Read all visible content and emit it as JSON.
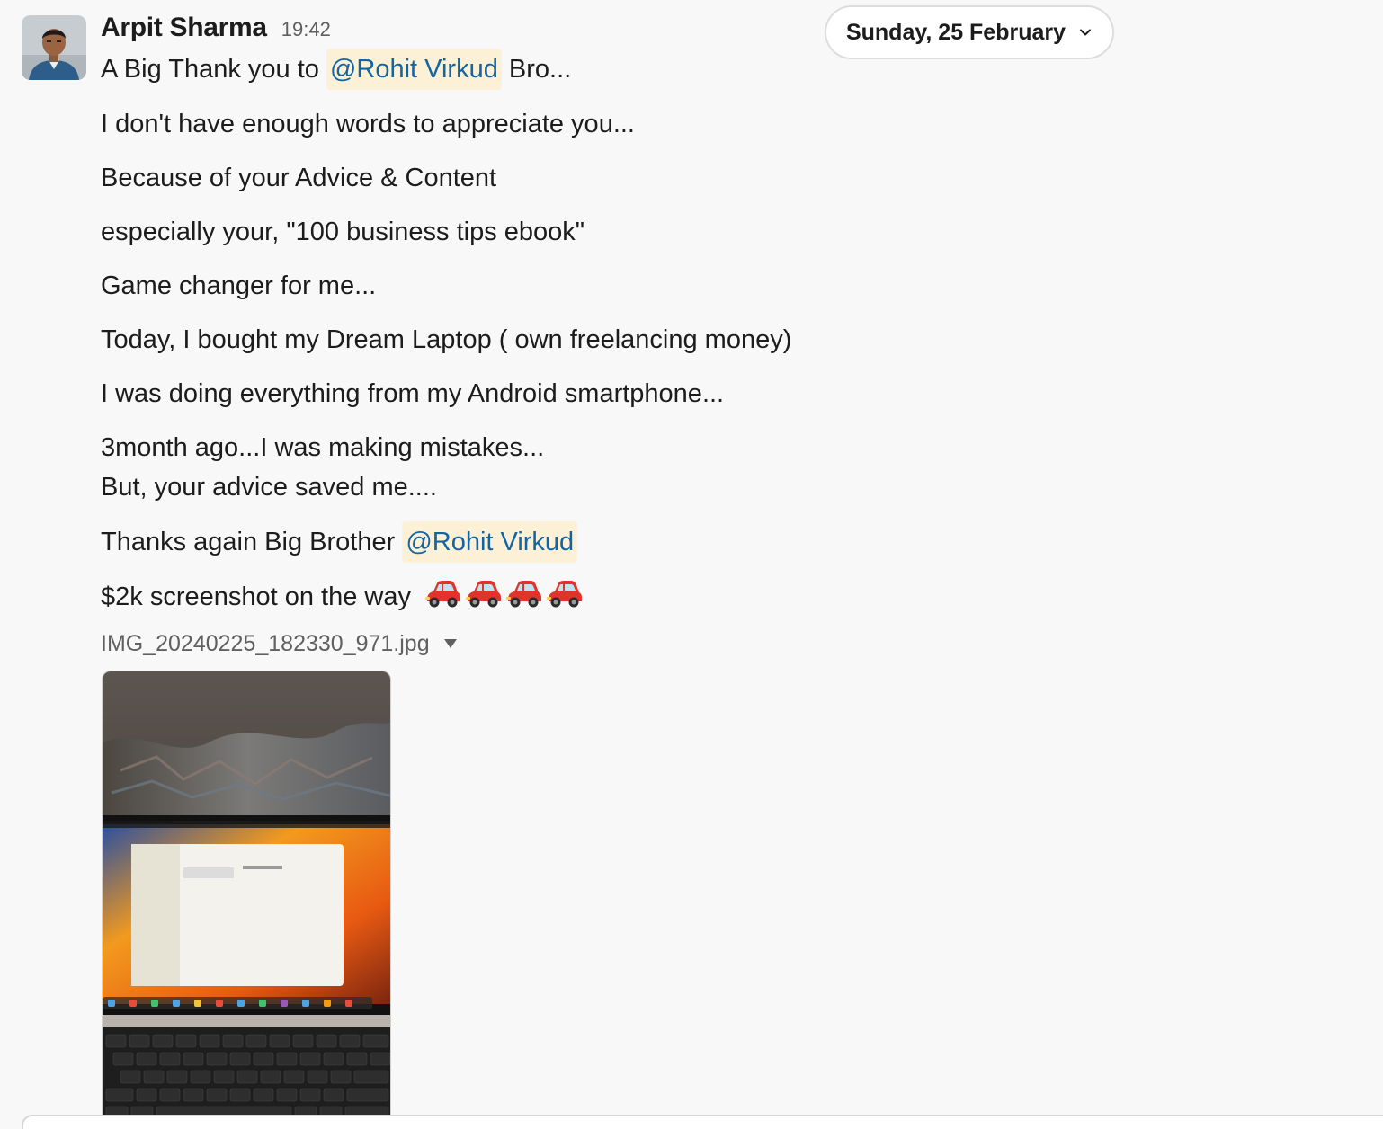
{
  "message": {
    "sender": "Arpit Sharma",
    "time": "19:42",
    "line1": {
      "before": "A Big Thank you to",
      "mention": "@Rohit Virkud",
      "after": "Bro..."
    },
    "line2": "I don't have enough words to appreciate you...",
    "line3": "Because of your Advice & Content",
    "line4": "especially your, \"100 business tips ebook\"",
    "line5": "Game changer for me...",
    "line6": "Today, I bought my Dream Laptop ( own freelancing money)",
    "line7": "I was doing everything from my Android smartphone...",
    "line8": "3month ago...I was making mistakes...",
    "line9": "But, your advice saved me....",
    "line10": {
      "before": "Thanks again Big Brother",
      "mention": "@Rohit Virkud"
    },
    "line11": {
      "text": "$2k screenshot on the way",
      "emoji": "red-car-emoji",
      "emoji_count": 4
    }
  },
  "date_divider": {
    "label": "Sunday, 25 February",
    "icon": "chevron-down-icon"
  },
  "attachment": {
    "file_name": "IMG_20240225_182330_971.jpg",
    "menu_icon": "triangle-down-icon",
    "preview_subject": "laptop photo"
  },
  "colors": {
    "background": "#f8f8f8",
    "mention_bg": "#fcf1d6",
    "mention_text": "#1264a3",
    "muted_text": "#616061",
    "body_text": "#1d1c1d"
  }
}
